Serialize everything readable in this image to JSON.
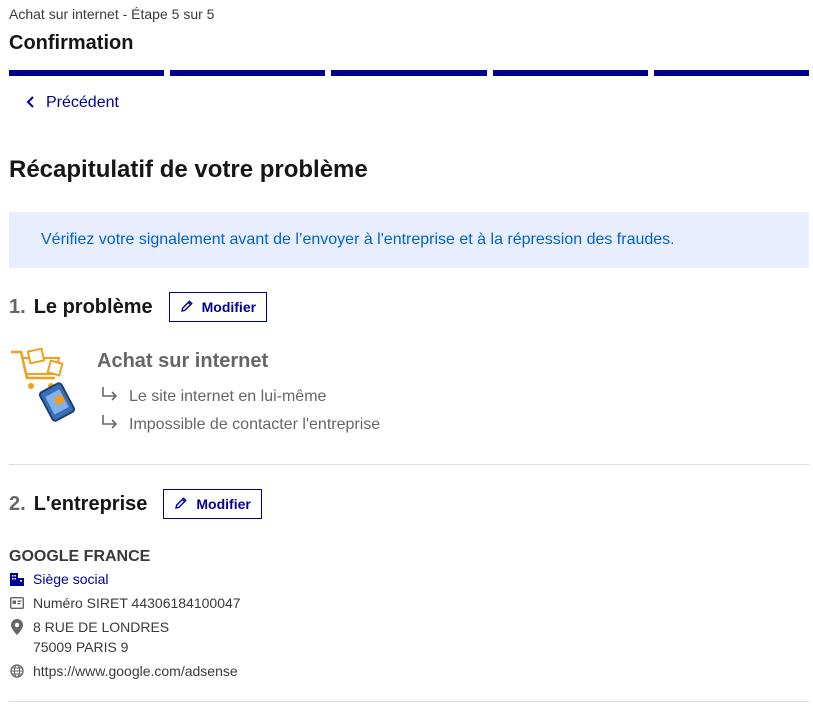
{
  "stepper": {
    "label": "Achat sur internet - Étape 5 sur 5",
    "title": "Confirmation",
    "total_steps": 5,
    "current_step": 5,
    "accent": "#000091"
  },
  "nav": {
    "back_label": "Précédent",
    "back_icon": "chevron-left-icon"
  },
  "page": {
    "title": "Récapitulatif de votre problème"
  },
  "callout": {
    "text": "Vérifiez votre signalement avant de l’envoyer à l'entreprise et à la répression des fraudes."
  },
  "section1": {
    "number": "1.",
    "title": "Le problème",
    "modify_label": "Modifier",
    "category": "Achat sur internet",
    "subcategories": [
      "Le site internet en lui-même",
      "Impossible de contacter l'entreprise"
    ]
  },
  "section2": {
    "number": "2.",
    "title": "L'entreprise",
    "modify_label": "Modifier",
    "company_name": "GOOGLE FRANCE",
    "siege": "Siège social",
    "siret": "Numéro SIRET 44306184100047",
    "address_line1": "8 RUE DE LONDRES",
    "address_line2": "75009 PARIS 9",
    "website": "https://www.google.com/adsense"
  },
  "colors": {
    "primary": "#000091",
    "callout_bg": "#e8edff",
    "callout_text": "#0063cb",
    "muted": "#666666"
  }
}
